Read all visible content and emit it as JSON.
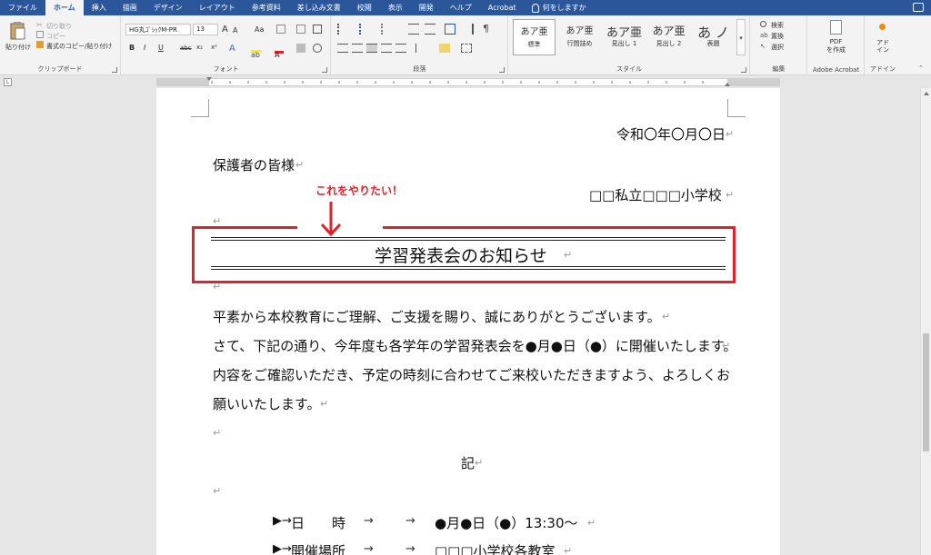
{
  "tabs": [
    {
      "label": "ファイル"
    },
    {
      "label": "ホーム",
      "active": true
    },
    {
      "label": "挿入"
    },
    {
      "label": "描画"
    },
    {
      "label": "デザイン"
    },
    {
      "label": "レイアウト"
    },
    {
      "label": "参考資料"
    },
    {
      "label": "差し込み文書"
    },
    {
      "label": "校閲"
    },
    {
      "label": "表示"
    },
    {
      "label": "開発"
    },
    {
      "label": "ヘルプ"
    },
    {
      "label": "Acrobat"
    }
  ],
  "tell_me": "何をしますか",
  "ribbon": {
    "clipboard": {
      "paste": "貼り付け",
      "cut": "切り取り",
      "copy": "コピー",
      "format_painter": "書式のコピー/貼り付け",
      "label": "クリップボード"
    },
    "font": {
      "font_name": "HG丸ｺﾞｼｯｸM-PR",
      "font_size": "13",
      "label": "フォント",
      "bold": "B",
      "italic": "I",
      "underline": "U",
      "strike": "abc",
      "sub": "x₂",
      "sup": "x²",
      "case": "Aa",
      "grow": "A",
      "shrink": "A"
    },
    "paragraph": {
      "label": "段落"
    },
    "styles": {
      "label": "スタイル",
      "items": [
        {
          "preview": "あア亜",
          "name": "標準"
        },
        {
          "preview": "あア亜",
          "name": "行間詰め"
        },
        {
          "preview": "あア亜",
          "name": "見出し 1"
        },
        {
          "preview": "あア亜",
          "name": "見出し 2"
        },
        {
          "preview": "あ ノ",
          "name": "表題"
        }
      ]
    },
    "editing": {
      "label": "編集",
      "find": "検索",
      "replace": "置換",
      "select": "選択"
    },
    "acrobat": {
      "label": "Adobe Acrobat",
      "create_pdf_line1": "PDF",
      "create_pdf_line2": "を作成"
    },
    "addins": {
      "label": "アドイン",
      "btn_line1": "アド",
      "btn_line2": "イン"
    }
  },
  "colors": {
    "word_blue": "#2b579a",
    "annotation_red": "#e0222a"
  },
  "document": {
    "date": "令和〇年〇月〇日",
    "recipient": "保護者の皆様",
    "sender": "□□私立□□□小学校",
    "annotation": "これをやりたい！",
    "title": "学習発表会のお知らせ",
    "body": [
      "平素から本校教育にご理解、ご支援を賜り、誠にありがとうございます。",
      "さて、下記の通り、今年度も各学年の学習発表会を●月●日（●）に開催いたします。",
      "内容をご確認いただき、予定の時刻に合わせてご来校いただきますよう、よろしくお",
      "願いいたします。"
    ],
    "ki": "記",
    "items": [
      {
        "label": "日　　時",
        "value": "●月●日（●）13:30〜"
      },
      {
        "label": "開催場所",
        "value": "□□□小学校各教室"
      }
    ]
  }
}
